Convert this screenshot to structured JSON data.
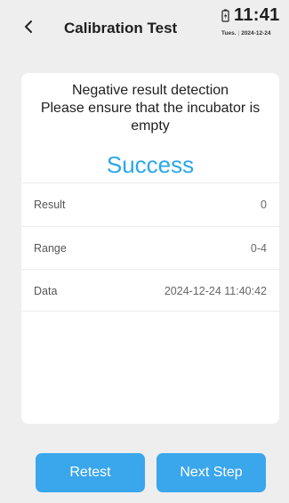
{
  "header": {
    "back_icon": "chevron-left-icon",
    "title": "Calibration Test",
    "battery_icon": "battery-charging-icon",
    "time": "11:41",
    "day": "Tues.",
    "date": "2024-12-24"
  },
  "card": {
    "message": "Negative result detection\nPlease ensure that the incubator is empty",
    "status": "Success",
    "rows": [
      {
        "label": "Result",
        "value": "0"
      },
      {
        "label": "Range",
        "value": "0-4"
      },
      {
        "label": "Data",
        "value": "2024-12-24 11:40:42"
      }
    ]
  },
  "actions": {
    "retest_label": "Retest",
    "next_label": "Next Step"
  },
  "colors": {
    "accent": "#3aa6ec",
    "success_text": "#2aa8ea",
    "background": "#eeeeee"
  }
}
